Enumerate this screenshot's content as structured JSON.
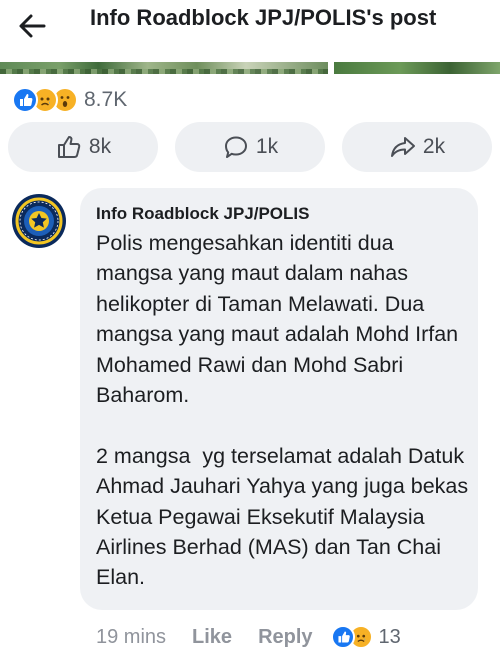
{
  "header": {
    "title": "Info Roadblock JPJ/POLIS's post"
  },
  "reactions": {
    "icons": [
      "like-icon",
      "sad-icon",
      "wow-icon"
    ],
    "count": "8.7K"
  },
  "actions": {
    "like_count": "8k",
    "comment_count": "1k",
    "share_count": "2k"
  },
  "comment": {
    "author": "Info Roadblock JPJ/POLIS",
    "avatar_icon": "police-badge-icon",
    "text": "Polis mengesahkan identiti dua mangsa yang maut dalam nahas helikopter di Taman Melawati. Dua mangsa yang maut adalah Mohd Irfan Mohamed Rawi dan Mohd Sabri Baharom.\n\n2 mangsa  yg terselamat adalah Datuk Ahmad Jauhari Yahya yang juga bekas Ketua Pegawai Eksekutif Malaysia Airlines Berhad (MAS) dan Tan Chai Elan.",
    "time": "19 mins",
    "like_label": "Like",
    "reply_label": "Reply",
    "reaction_icons": [
      "like-icon",
      "sad-icon"
    ],
    "reaction_count": "13"
  },
  "colors": {
    "like_blue": "#1877f2",
    "reaction_yellow": "#f7b125",
    "bubble_bg": "#eff1f4",
    "button_bg": "#eef0f3",
    "muted_text": "#90949c"
  }
}
